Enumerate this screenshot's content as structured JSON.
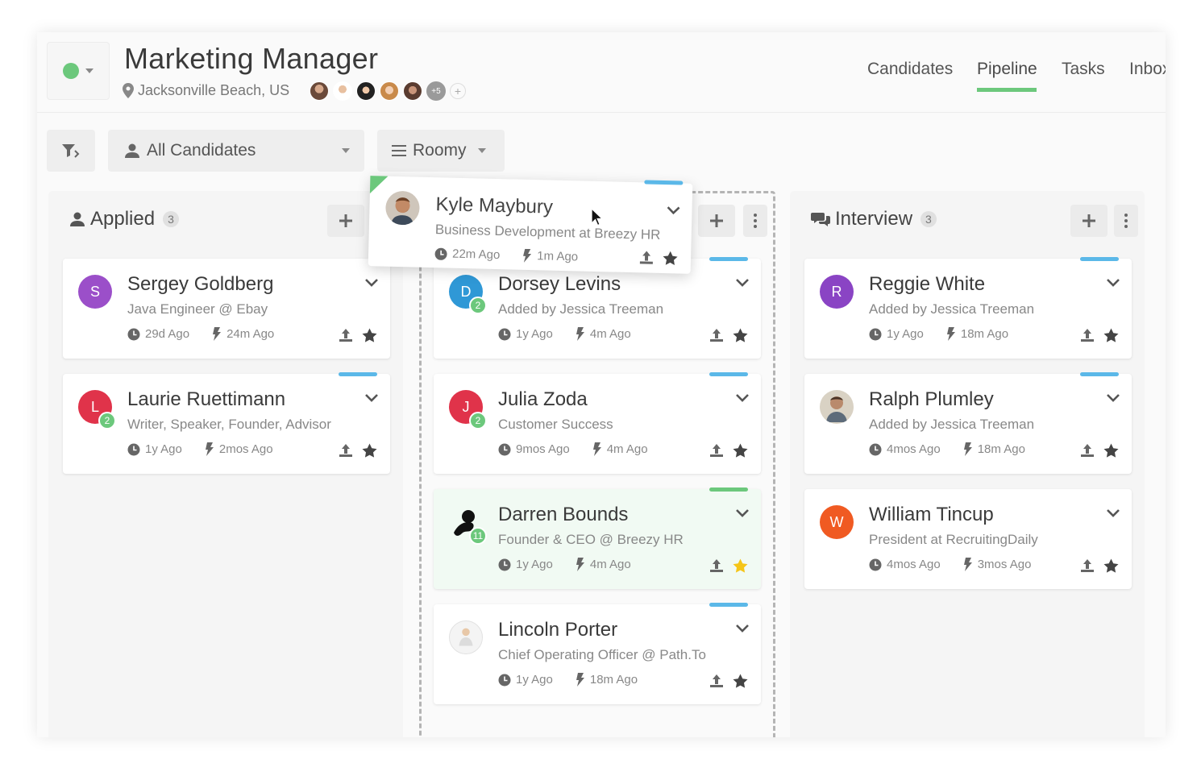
{
  "header": {
    "title": "Marketing Manager",
    "location": "Jacksonville Beach, US",
    "team_more": "+5",
    "team_add": "+",
    "status_color": "#6cc87c"
  },
  "nav": {
    "candidates": "Candidates",
    "pipeline": "Pipeline",
    "tasks": "Tasks",
    "inbox": "Inbox",
    "active": "Pipeline"
  },
  "toolbar": {
    "filter_select": "All Candidates",
    "view_select": "Roomy"
  },
  "columns": {
    "applied": {
      "title": "Applied",
      "count": "3"
    },
    "interview": {
      "title": "Interview",
      "count": "3"
    }
  },
  "dragging_card": {
    "name": "Kyle Maybury",
    "subtitle": "Business Development at Breezy HR",
    "added": "22m Ago",
    "activity": "1m Ago"
  },
  "cards": {
    "applied": [
      {
        "name": "Sergey Goldberg",
        "subtitle": "Java Engineer @ Ebay",
        "added": "29d Ago",
        "activity": "24m Ago",
        "initial": "S",
        "color": "#9b4fc9"
      },
      {
        "name": "Laurie Ruettimann",
        "subtitle": "Writer, Speaker, Founder, Advisor",
        "added": "1y Ago",
        "activity": "2mos Ago",
        "initial": "L",
        "color": "#e0334a",
        "badge": "2"
      }
    ],
    "middle": [
      {
        "name": "Dorsey Levins",
        "subtitle": "Added by Jessica Treeman",
        "added": "1y Ago",
        "activity": "4m Ago",
        "initial": "D",
        "color": "#2f98d6",
        "badge": "2"
      },
      {
        "name": "Julia Zoda",
        "subtitle": "Customer Success",
        "added": "9mos Ago",
        "activity": "4m Ago",
        "initial": "J",
        "color": "#e0334a",
        "badge": "2"
      },
      {
        "name": "Darren Bounds",
        "subtitle": "Founder & CEO @ Breezy HR",
        "added": "1y Ago",
        "activity": "4m Ago",
        "badge": "11"
      },
      {
        "name": "Lincoln Porter",
        "subtitle": "Chief Operating Officer @ Path.To",
        "added": "1y Ago",
        "activity": "18m Ago"
      }
    ],
    "interview": [
      {
        "name": "Reggie White",
        "subtitle": "Added by Jessica Treeman",
        "added": "1y Ago",
        "activity": "18m Ago",
        "initial": "R",
        "color": "#8a44c4"
      },
      {
        "name": "Ralph Plumley",
        "subtitle": "Added by Jessica Treeman",
        "added": "4mos Ago",
        "activity": "18m Ago"
      },
      {
        "name": "William Tincup",
        "subtitle": "President at RecruitingDaily",
        "added": "4mos Ago",
        "activity": "3mos Ago",
        "initial": "W",
        "color": "#f05a22"
      }
    ]
  },
  "colors": {
    "accent_green": "#6cc87c",
    "tab_blue": "#5bb8e8",
    "star_gold": "#f5c518"
  }
}
